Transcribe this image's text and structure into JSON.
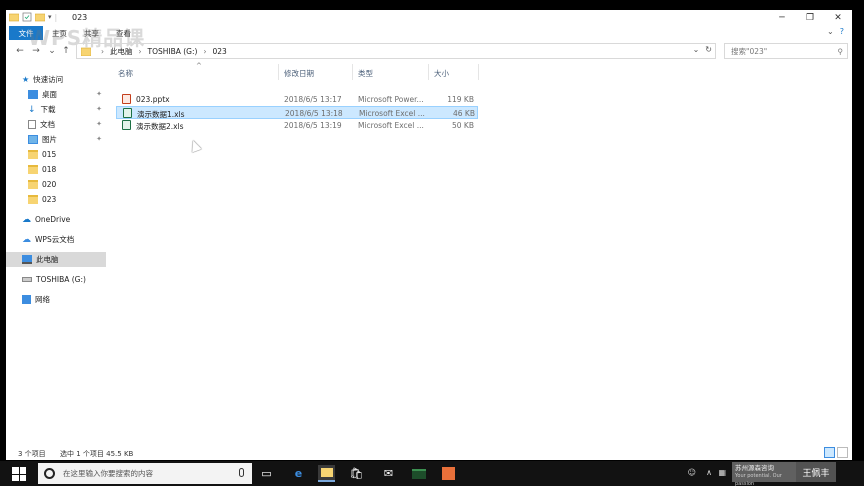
{
  "window": {
    "title": "023"
  },
  "ribbon": {
    "file_tab": "文件",
    "tabs": [
      "主页",
      "共享",
      "查看"
    ],
    "watermark": "WPS精品课"
  },
  "address": {
    "crumbs": [
      "此电脑",
      "TOSHIBA (G:)",
      "023"
    ],
    "search_placeholder": "搜索\"023\""
  },
  "sidebar": {
    "items": [
      {
        "label": "快速访问",
        "icon": "star-icon",
        "pinned": false
      },
      {
        "label": "桌面",
        "icon": "desktop-icon",
        "pinned": true
      },
      {
        "label": "下载",
        "icon": "download-icon",
        "pinned": true
      },
      {
        "label": "文档",
        "icon": "document-icon",
        "pinned": true
      },
      {
        "label": "图片",
        "icon": "picture-icon",
        "pinned": true
      },
      {
        "label": "015",
        "icon": "folder-icon",
        "pinned": false
      },
      {
        "label": "018",
        "icon": "folder-icon",
        "pinned": false
      },
      {
        "label": "020",
        "icon": "folder-icon",
        "pinned": false
      },
      {
        "label": "023",
        "icon": "folder-icon",
        "pinned": false
      },
      {
        "label": "OneDrive",
        "icon": "cloud-icon",
        "pinned": false
      },
      {
        "label": "WPS云文档",
        "icon": "cloud-icon",
        "pinned": false
      },
      {
        "label": "此电脑",
        "icon": "computer-icon",
        "pinned": false
      },
      {
        "label": "TOSHIBA (G:)",
        "icon": "drive-icon",
        "pinned": false
      },
      {
        "label": "网络",
        "icon": "network-icon",
        "pinned": false
      }
    ]
  },
  "list": {
    "columns": [
      "名称",
      "修改日期",
      "类型",
      "大小"
    ],
    "rows": [
      {
        "name": "023.pptx",
        "date": "2018/6/5 13:17",
        "type": "Microsoft Power...",
        "size": "119 KB",
        "kind": "ppt"
      },
      {
        "name": "演示数据1.xls",
        "date": "2018/6/5 13:18",
        "type": "Microsoft Excel ...",
        "size": "46 KB",
        "kind": "xls"
      },
      {
        "name": "演示数据2.xls",
        "date": "2018/6/5 13:19",
        "type": "Microsoft Excel ...",
        "size": "50 KB",
        "kind": "xls"
      }
    ]
  },
  "status": {
    "count": "3 个项目",
    "selected": "选中 1 个项目  45.5 KB"
  },
  "taskbar": {
    "search_placeholder": "在这里输入你要搜索的内容",
    "overlay_org": "苏州源森咨询",
    "overlay_slogan": "Your potential. Our passion",
    "overlay_name": "王佩丰"
  },
  "colors": {
    "accent": "#1979ca",
    "selection": "#cce8ff",
    "folder": "#f7d472"
  }
}
